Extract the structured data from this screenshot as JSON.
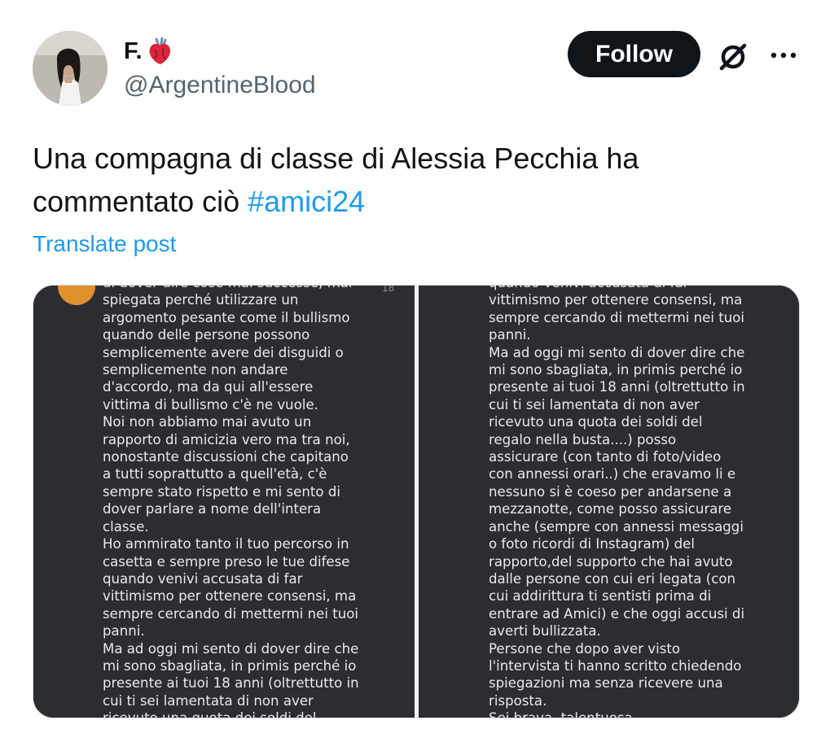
{
  "author": {
    "display_name": "F.",
    "emoji": "anatomical-heart",
    "handle": "@ArgentineBlood"
  },
  "actions": {
    "follow_label": "Follow",
    "grok_icon": "grok-icon",
    "more_icon": "more-icon"
  },
  "tweet": {
    "text": "Una compagna di classe di Alessia Pecchia ha commentato ciò",
    "hashtag": "#amici24",
    "translate_label": "Translate post"
  },
  "media": {
    "left_number": "18",
    "left_text": "di dover dire cose mai successe, mai\nspiegata perché utilizzare un\nargomento pesante come il bullismo\nquando delle persone possono\nsemplicemente avere dei disguidi o\nsemplicemente non andare\nd'accordo, ma da qui all'essere\nvittima di bullismo c'è ne vuole.\nNoi non abbiamo mai avuto un\nrapporto di amicizia vero ma tra noi,\nnonostante discussioni che capitano\na tutti soprattutto a quell'età, c'è\nsempre stato rispetto e mi sento di\ndover parlare a nome dell'intera\nclasse.\nHo ammirato tanto il tuo percorso in\ncasetta e sempre preso le tue difese\nquando venivi accusata di far\nvittimismo per ottenere consensi, ma\nsempre cercando di mettermi nei tuoi\npanni.\nMa ad oggi mi sento di dover dire che\nmi sono sbagliata, in primis perché io\npresente ai tuoi 18 anni (oltrettutto in\ncui ti sei lamentata di non aver\nricevuto una quota dei soldi del",
    "right_text": "quando venivi accusata di far\nvittimismo per ottenere consensi, ma\nsempre cercando di mettermi nei tuoi\npanni.\nMa ad oggi mi sento di dover dire che\nmi sono sbagliata, in primis perché io\npresente ai tuoi 18 anni (oltrettutto in\ncui ti sei lamentata di non aver\nricevuto una quota dei soldi del\nregalo nella busta....) posso\nassicurare (con tanto di foto/video\ncon annessi orari..) che eravamo li e\nnessuno si è coeso per andarsene a\nmezzanotte, come posso assicurare\nanche (sempre con annessi messaggi\no foto ricordi di Instagram) del\nrapporto,del supporto che hai avuto\ndalle persone con cui eri legata (con\ncui addirittura ti sentisti prima di\nentrare ad Amici) e che oggi accusi di\naverti bullizzata.\nPersone che dopo aver visto\nl'intervista ti hanno scritto chiedendo\nspiegazioni ma senza ricevere una\nrisposta.\nSei brava, talentuosa"
  },
  "colors": {
    "link": "#1d9bf0",
    "text": "#0f1419",
    "secondary": "#536471",
    "follow_bg": "#0f1419",
    "screenshot_bg": "#2b2d31"
  }
}
